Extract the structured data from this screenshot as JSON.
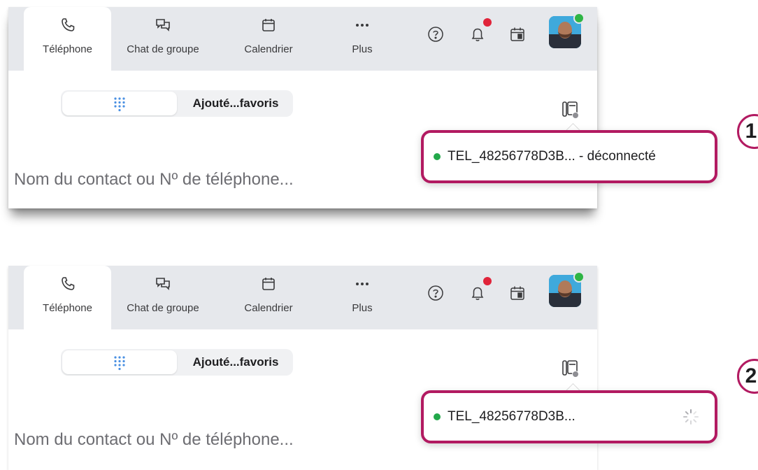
{
  "panels": [
    {
      "tabs": [
        {
          "label": "Téléphone",
          "icon": "phone-icon",
          "active": true
        },
        {
          "label": "Chat de groupe",
          "icon": "chat-icon"
        },
        {
          "label": "Calendrier",
          "icon": "calendar-icon"
        },
        {
          "label": "Plus",
          "icon": "more-icon"
        }
      ],
      "segment": {
        "favorites_label": "Ajouté...favoris",
        "keypad_icon": "keypad-icon"
      },
      "search_placeholder": "Nom du contact ou Nº de téléphone...",
      "device_popup": {
        "text": "TEL_48256778D3B... - déconnecté",
        "status_color": "#22a84a"
      },
      "step_badge": "1"
    },
    {
      "tabs": [
        {
          "label": "Téléphone",
          "icon": "phone-icon",
          "active": true
        },
        {
          "label": "Chat de groupe",
          "icon": "chat-icon"
        },
        {
          "label": "Calendrier",
          "icon": "calendar-icon"
        },
        {
          "label": "Plus",
          "icon": "more-icon"
        }
      ],
      "segment": {
        "favorites_label": "Ajouté...favoris",
        "keypad_icon": "keypad-icon"
      },
      "search_placeholder": "Nom du contact ou Nº de téléphone...",
      "device_popup": {
        "text": "TEL_48256778D3B...",
        "status_color": "#22a84a",
        "loading": true
      },
      "step_badge": "2"
    }
  ],
  "colors": {
    "accent": "#b21a61",
    "notification": "#e0243a",
    "presence": "#2fb545",
    "keypad": "#4a90e2"
  }
}
